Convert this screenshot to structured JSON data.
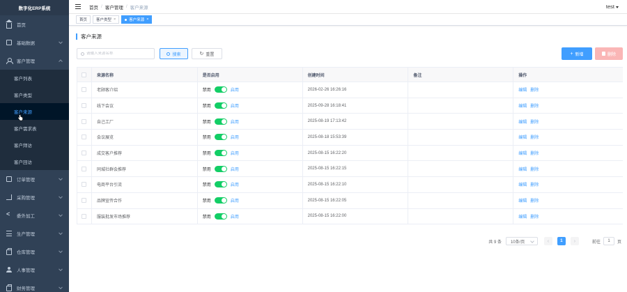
{
  "app": {
    "title": "数字化ERP系统"
  },
  "sidebar": {
    "items": [
      {
        "label": "首页",
        "icon": "home-icon"
      },
      {
        "label": "基础数据",
        "icon": "doc-icon"
      },
      {
        "label": "客户管理",
        "icon": "user-icon",
        "expanded": true,
        "children": [
          {
            "label": "客户列表"
          },
          {
            "label": "客户类型"
          },
          {
            "label": "客户来源",
            "active": true
          },
          {
            "label": "客户需求表"
          },
          {
            "label": "客户拜访"
          },
          {
            "label": "客户回访"
          }
        ]
      },
      {
        "label": "订单管理",
        "icon": "doc-icon"
      },
      {
        "label": "采购管理",
        "icon": "cart-icon"
      },
      {
        "label": "委外加工",
        "icon": "share-icon"
      },
      {
        "label": "生产管理",
        "icon": "list-icon"
      },
      {
        "label": "仓库管理",
        "icon": "bag-icon"
      },
      {
        "label": "人事管理",
        "icon": "person-icon"
      },
      {
        "label": "财务管理",
        "icon": "bag-icon"
      }
    ]
  },
  "navbar": {
    "breadcrumb": [
      "首页",
      "客户管理",
      "客户来源"
    ],
    "user": "test"
  },
  "tags": [
    {
      "label": "首页",
      "closable": false
    },
    {
      "label": "客户类型",
      "closable": true
    },
    {
      "label": "客户来源",
      "closable": true,
      "active": true
    }
  ],
  "page": {
    "title": "客户来源",
    "search": {
      "placeholder": "请输入来源名称",
      "value": ""
    },
    "buttons": {
      "search": "搜索",
      "reset": "重置",
      "add": "新增",
      "delete": "删除"
    }
  },
  "table": {
    "headers": [
      "来源名称",
      "是否启用",
      "创建时间",
      "备注",
      "操作"
    ],
    "switch_off_label": "禁用",
    "switch_on_label": "启用",
    "action_edit": "编辑",
    "action_delete": "删除",
    "rows": [
      {
        "name": "老顾客介绍",
        "enabled": true,
        "created": "2026-02-26 16:26:16",
        "remark": ""
      },
      {
        "name": "线下会议",
        "enabled": true,
        "created": "2025-09-28 16:18:41",
        "remark": ""
      },
      {
        "name": "自己工厂",
        "enabled": true,
        "created": "2025-08-19 17:13:42",
        "remark": ""
      },
      {
        "name": "会议展览",
        "enabled": true,
        "created": "2025-08-18 15:53:39",
        "remark": ""
      },
      {
        "name": "成交客户推荐",
        "enabled": true,
        "created": "2025-08-15 16:22:20",
        "remark": ""
      },
      {
        "name": "同城社群会推荐",
        "enabled": true,
        "created": "2025-08-15 16:22:15",
        "remark": ""
      },
      {
        "name": "电商平台引流",
        "enabled": true,
        "created": "2025-08-15 16:22:10",
        "remark": ""
      },
      {
        "name": "品牌宣传合作",
        "enabled": true,
        "created": "2025-08-15 16:22:05",
        "remark": ""
      },
      {
        "name": "服装批发市场推荐",
        "enabled": true,
        "created": "2025-08-15 16:22:00",
        "remark": ""
      }
    ]
  },
  "pagination": {
    "total": "共 9 条",
    "page_size": "10条/页",
    "current": "1",
    "goto_prefix": "前往",
    "goto_value": "1",
    "goto_suffix": "页"
  },
  "colors": {
    "sidebar_bg": "#304156",
    "primary": "#409eff",
    "switch_on": "#13ce66",
    "danger_light": "#fab6b6"
  }
}
